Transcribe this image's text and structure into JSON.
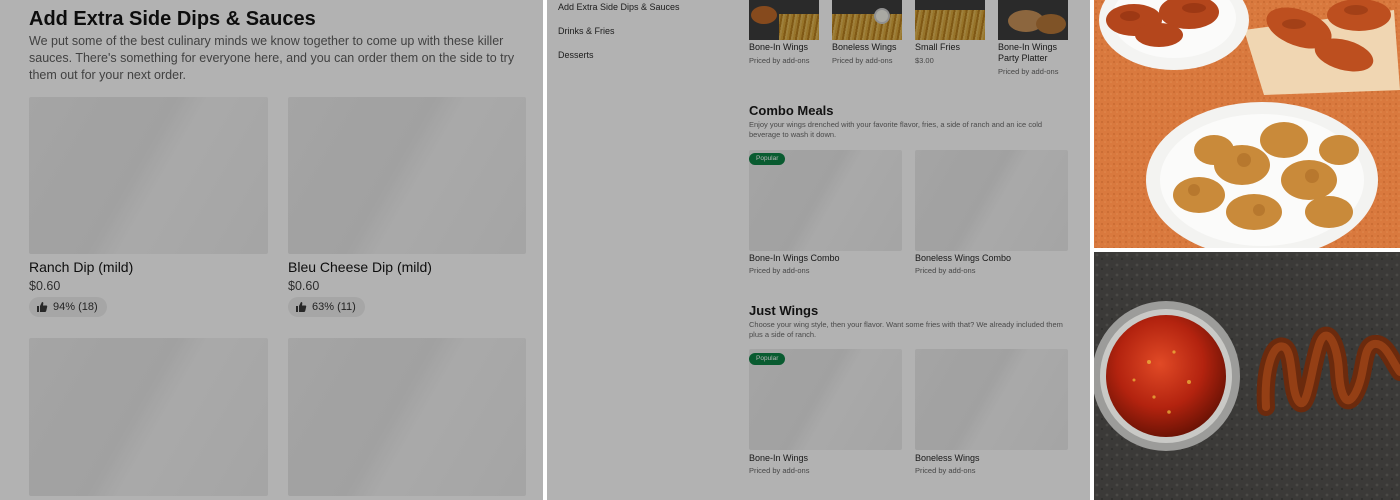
{
  "left_panel": {
    "title": "Add Extra Side Dips & Sauces",
    "description": "We put some of the best culinary minds we know together to come up with these killer sauces. There's something for everyone here, and you can order them on the side to try them out for your next order.",
    "items": [
      {
        "name": "Ranch Dip (mild)",
        "price": "$0.60",
        "rating": "94% (18)"
      },
      {
        "name": "Bleu Cheese Dip (mild)",
        "price": "$0.60",
        "rating": "63% (11)"
      }
    ]
  },
  "middle_panel": {
    "nav": [
      "Add Extra Side Dips & Sauces",
      "Drinks & Fries",
      "Desserts"
    ],
    "top_items": [
      {
        "name": "Bone-In Wings",
        "sub": "Priced by add-ons"
      },
      {
        "name": "Boneless Wings",
        "sub": "Priced by add-ons"
      },
      {
        "name": "Small Fries",
        "sub": "$3.00"
      },
      {
        "name": "Bone-In Wings Party Platter",
        "sub": "Priced by add-ons"
      }
    ],
    "sections": [
      {
        "title": "Combo Meals",
        "description": "Enjoy your wings drenched with your favorite flavor, fries, a side of ranch and an ice cold beverage to wash it down.",
        "items": [
          {
            "name": "Bone-In Wings Combo",
            "sub": "Priced by add-ons",
            "badge": "Popular"
          },
          {
            "name": "Boneless Wings Combo",
            "sub": "Priced by add-ons"
          }
        ]
      },
      {
        "title": "Just Wings",
        "description": "Choose your wing style, then your flavor. Want some fries with that? We already included them plus a side of ranch.",
        "items": [
          {
            "name": "Bone-In Wings",
            "sub": "Priced by add-ons",
            "badge": "Popular"
          },
          {
            "name": "Boneless Wings",
            "sub": "Priced by add-ons"
          }
        ]
      }
    ]
  },
  "colors": {
    "overlay": "#000000",
    "popular_badge": "#0e8345",
    "photo_background": "#d9793e",
    "photo_surface": "#3b3a38"
  }
}
